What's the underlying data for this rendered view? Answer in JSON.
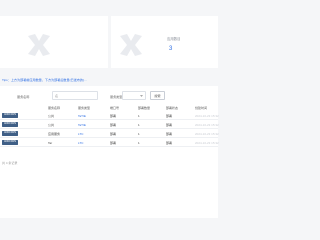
{
  "stats": {
    "right": {
      "title": "应用数目",
      "value": "3"
    }
  },
  "tip": "Tips：上方为部署前应用数量，下方为部署后数量(已发布的)...",
  "filters": {
    "name_label": "服务名称",
    "name_placeholder": "名",
    "type_label": "服务类型",
    "type_value": "",
    "search_label": "搜索"
  },
  "table": {
    "headers": [
      "服务",
      "服务名称",
      "服务类型",
      "端口号",
      "部署数量",
      "部署状态",
      "创建时间"
    ],
    "rows": [
      {
        "tag": "ADDFDRS",
        "name": "公共",
        "type": "TaTIE",
        "port": "部署",
        "count": "1",
        "status": "部署",
        "time": "2024-10-23 15:32"
      },
      {
        "tag": "ADDFDRS",
        "name": "公共",
        "type": "TaTIE",
        "port": "部署",
        "count": "1",
        "status": "部署",
        "time": "2024-10-23 15:32"
      },
      {
        "tag": "ADDFDRS",
        "name": "应用服务",
        "type": "LTC",
        "port": "部署",
        "count": "1",
        "status": "部署",
        "time": "2024-10-23 15:32"
      },
      {
        "tag": "ADDFDRS",
        "name": "Tar",
        "type": "LTC",
        "port": "部署",
        "count": "1",
        "status": "部署",
        "time": "2024-10-23 15:32"
      }
    ]
  },
  "footer": "共 4 条记录",
  "colors": {
    "accent": "#2f6fe4",
    "tag": "#3f5f86",
    "watermark": "#e9ebef"
  }
}
